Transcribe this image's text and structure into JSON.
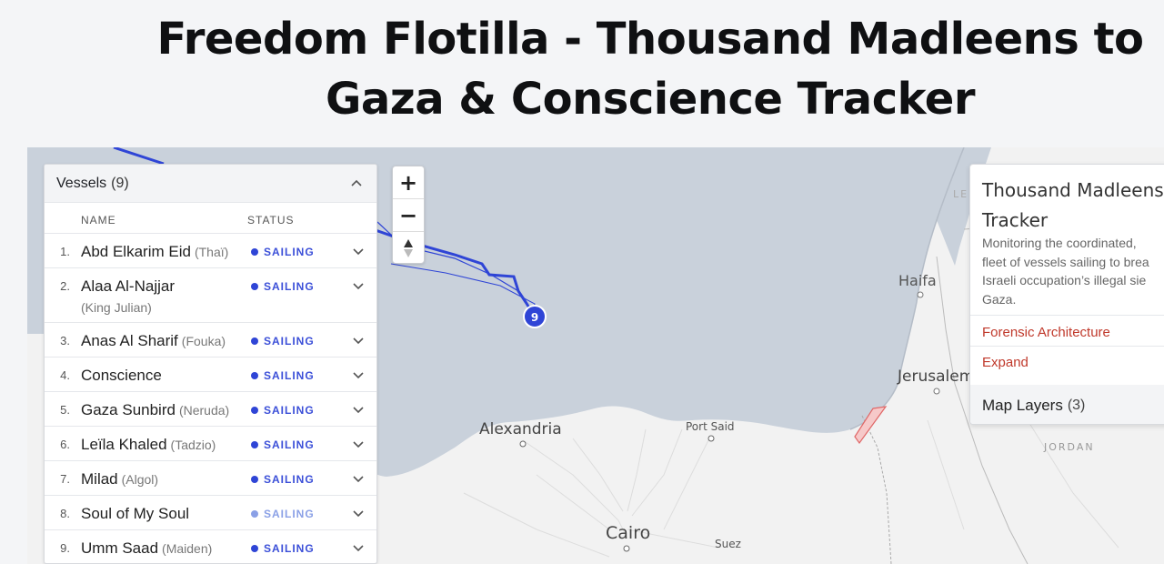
{
  "page": {
    "title": "Freedom Flotilla - Thousand Madleens to Gaza & Conscience Tracker"
  },
  "map": {
    "labels": {
      "alexandria": "Alexandria",
      "port_said": "Port Said",
      "cairo": "Cairo",
      "suez": "Suez",
      "haifa": "Haifa",
      "jerusalem": "Jerusalem",
      "jordan": "JORDAN",
      "lebanon_partial": "LE"
    },
    "cluster_marker": "9",
    "colors": {
      "sea": "#c9d1db",
      "land": "#f2f2f2",
      "route": "#2f45d6",
      "gaza_highlight": "#e88a8a"
    }
  },
  "zoom": {
    "zoom_in": "+",
    "zoom_out": "−",
    "reset_north": "▲"
  },
  "vessels": {
    "title": "Vessels",
    "count": "(9)",
    "columns": {
      "name": "NAME",
      "status": "STATUS"
    },
    "items": [
      {
        "num": "1.",
        "name": "Abd Elkarim Eid",
        "alias": "(Thaï)",
        "status": "SAILING",
        "faded": false
      },
      {
        "num": "2.",
        "name": "Alaa Al-Najjar",
        "alias": "(King Julian)",
        "status": "SAILING",
        "faded": false
      },
      {
        "num": "3.",
        "name": "Anas Al Sharif",
        "alias": "(Fouka)",
        "status": "SAILING",
        "faded": false
      },
      {
        "num": "4.",
        "name": "Conscience",
        "alias": "",
        "status": "SAILING",
        "faded": false
      },
      {
        "num": "5.",
        "name": "Gaza Sunbird",
        "alias": "(Neruda)",
        "status": "SAILING",
        "faded": false
      },
      {
        "num": "6.",
        "name": "Leïla Khaled",
        "alias": "(Tadzio)",
        "status": "SAILING",
        "faded": false
      },
      {
        "num": "7.",
        "name": "Milad",
        "alias": "(Algol)",
        "status": "SAILING",
        "faded": false
      },
      {
        "num": "8.",
        "name": "Soul of My Soul",
        "alias": "",
        "status": "SAILING",
        "faded": true
      },
      {
        "num": "9.",
        "name": "Umm Saad",
        "alias": "(Maiden)",
        "status": "SAILING",
        "faded": false
      }
    ]
  },
  "info": {
    "title": "Thousand Madleens to Gaza & Conscience Tracker",
    "title_visible_line1": "Thousand Madleens t",
    "title_visible_line2": "Tracker",
    "desc_lines": [
      "Monitoring the coordinated,",
      "fleet of vessels sailing to brea",
      "Israeli occupation’s illegal sie",
      "Gaza."
    ],
    "forensic_link": "Forensic Architecture",
    "expand_link": "Expand",
    "layers_label": "Map Layers",
    "layers_count": "(3)"
  }
}
